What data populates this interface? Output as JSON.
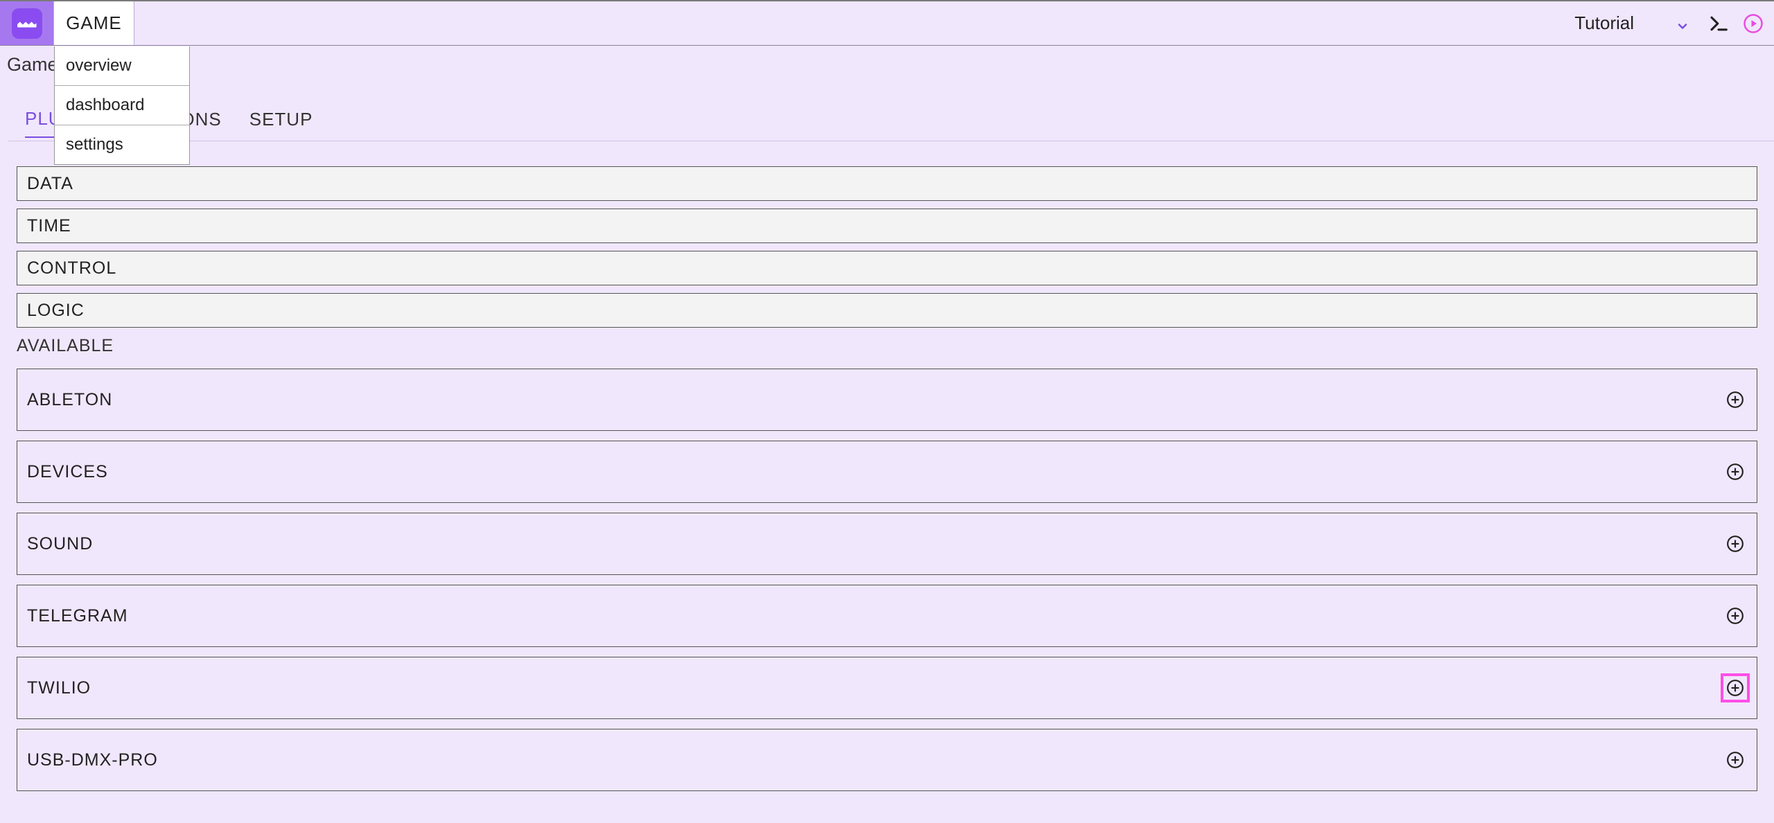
{
  "topbar": {
    "menu_label": "GAME",
    "dropdown": {
      "overview": "overview",
      "dashboard": "dashboard",
      "settings": "settings"
    },
    "project_selector": "Tutorial"
  },
  "page_title": "Game Settings",
  "tabs": {
    "plugins": "PLUGINS",
    "actions": "ACTIONS",
    "setup": "SETUP"
  },
  "installed_plugins": {
    "data": "DATA",
    "time": "TIME",
    "control": "CONTROL",
    "logic": "LOGIC"
  },
  "available_label": "AVAILABLE",
  "available_plugins": {
    "ableton": "ABLETON",
    "devices": "DEVICES",
    "sound": "SOUND",
    "telegram": "TELEGRAM",
    "twilio": "TWILIO",
    "usb_dmx_pro": "USB-DMX-PRO"
  }
}
